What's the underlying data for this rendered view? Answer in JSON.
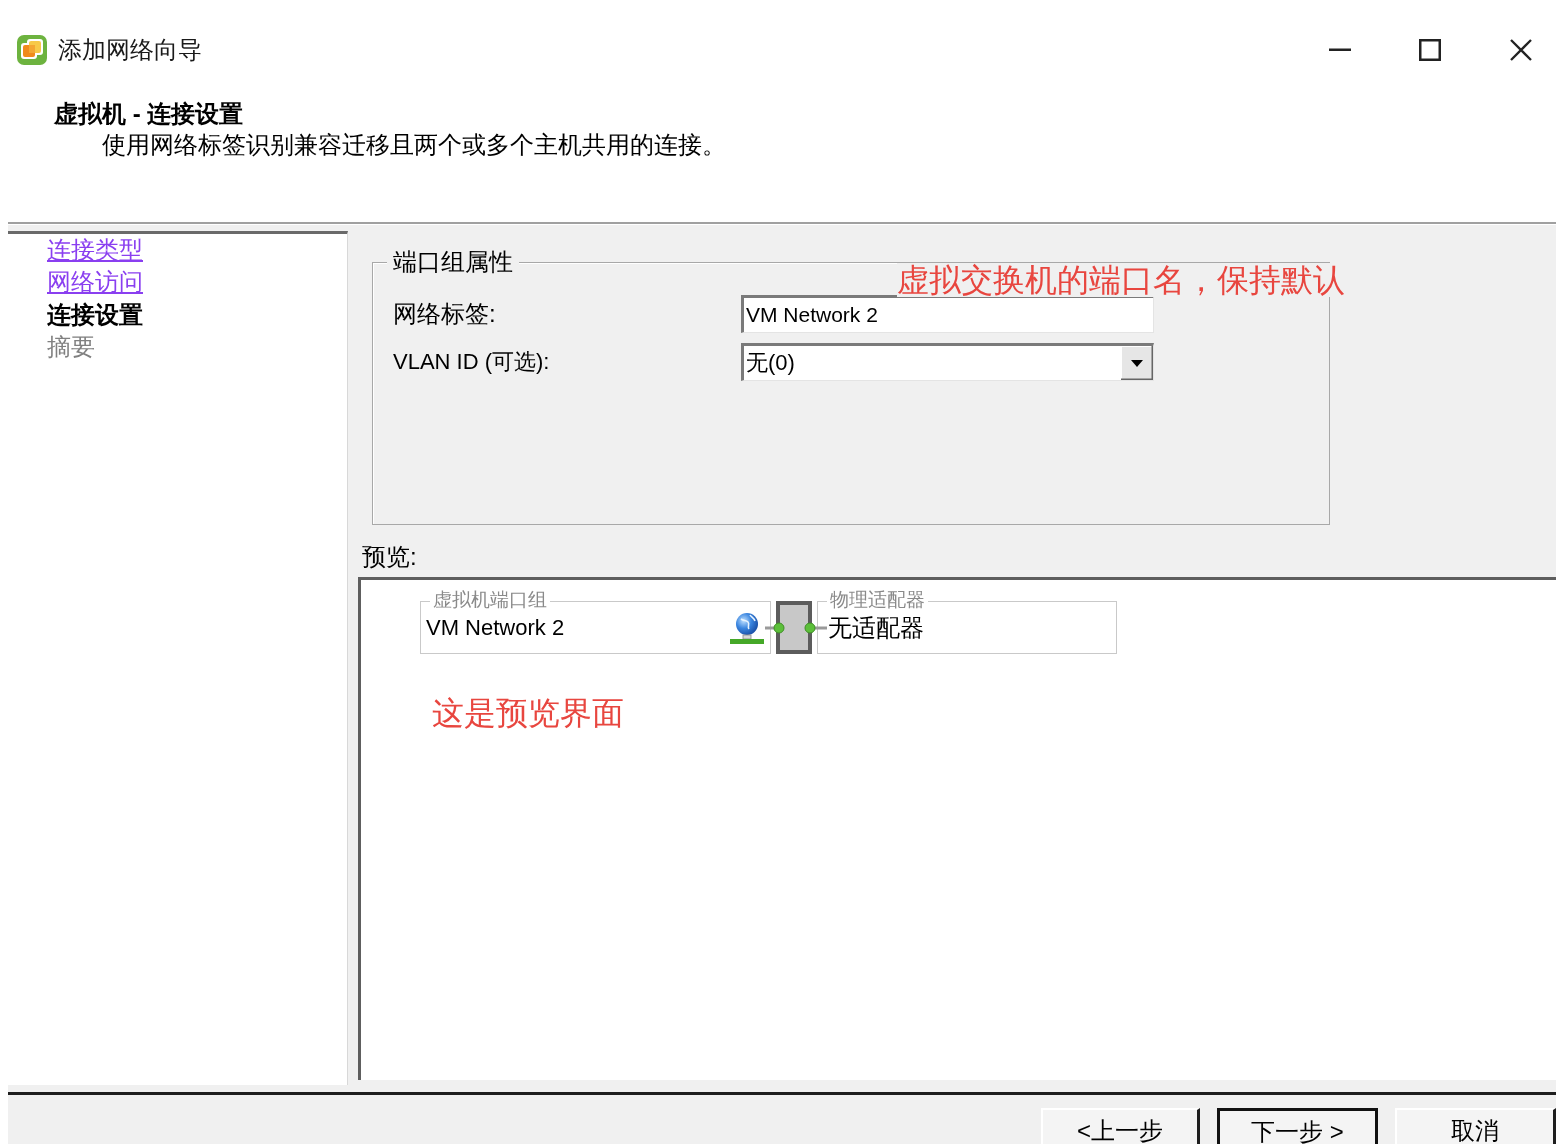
{
  "window": {
    "title": "添加网络向导"
  },
  "header": {
    "title": "虚拟机 - 连接设置",
    "subtitle": "使用网络标签识别兼容迁移且两个或多个主机共用的连接。"
  },
  "steps": [
    {
      "label": "连接类型",
      "kind": "link",
      "selected": false,
      "disabled": false
    },
    {
      "label": "网络访问",
      "kind": "link",
      "selected": false,
      "disabled": false
    },
    {
      "label": "连接设置",
      "kind": "text",
      "selected": true,
      "disabled": false
    },
    {
      "label": "摘要",
      "kind": "text",
      "selected": false,
      "disabled": true
    }
  ],
  "port_group_properties": {
    "legend": "端口组属性",
    "annotation": "虚拟交换机的端口名，保持默认",
    "fields": [
      {
        "kind": "text",
        "label": "网络标签:",
        "value": "VM Network 2"
      },
      {
        "kind": "dropdown",
        "label": "VLAN ID (可选):",
        "value": "无(0)"
      }
    ]
  },
  "preview": {
    "label": "预览:",
    "port_group": {
      "legend": "虚拟机端口组",
      "name": "VM Network 2"
    },
    "adapter": {
      "legend": "物理适配器",
      "name": "无适配器"
    },
    "annotation": "这是预览界面"
  },
  "buttons": [
    {
      "label": "<上一步",
      "default": false
    },
    {
      "label": "下一步 >",
      "default": true
    },
    {
      "label": "取消",
      "default": false
    }
  ]
}
